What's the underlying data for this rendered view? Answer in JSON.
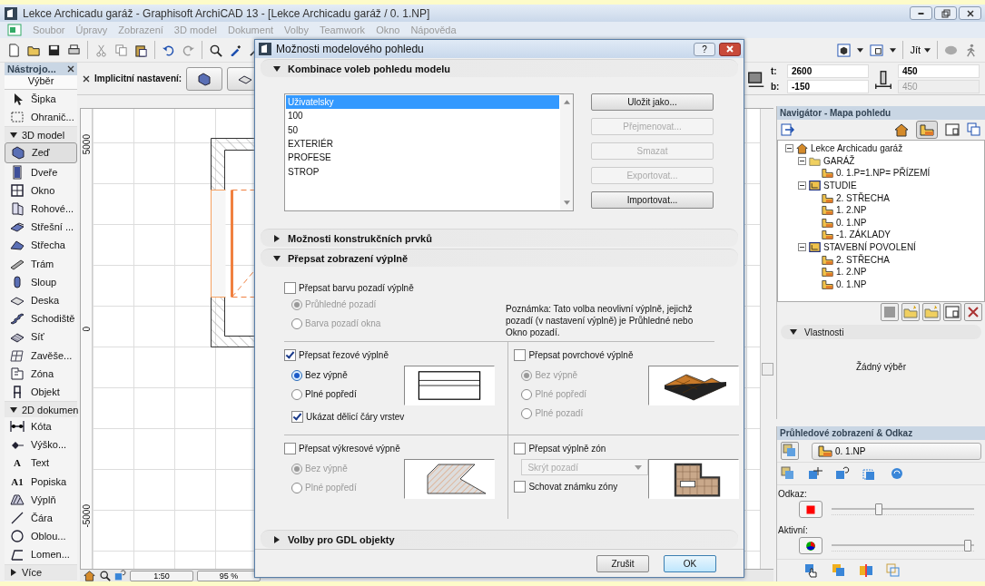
{
  "window": {
    "title": "Lekce Archicadu garáž - Graphisoft ArchiCAD 13 - [Lekce Archicadu garáž / 0. 1.NP]"
  },
  "menu": [
    "Soubor",
    "Úpravy",
    "Zobrazení",
    "3D model",
    "Dokument",
    "Volby",
    "Teamwork",
    "Okno",
    "Nápověda"
  ],
  "toolbar": {
    "go_label": "Jít"
  },
  "toolbox": {
    "title": "Nástrojo...",
    "header": "Výběr",
    "items": [
      {
        "label": "Šipka",
        "selected": false
      },
      {
        "label": "Ohranič...",
        "selected": false
      }
    ],
    "groups": [
      {
        "label": "3D model",
        "expanded": true,
        "items": [
          {
            "label": "Zeď",
            "selected": true
          },
          {
            "label": "Dveře",
            "selected": false
          },
          {
            "label": "Okno",
            "selected": false
          },
          {
            "label": "Rohové...",
            "selected": false
          },
          {
            "label": "Střešní ...",
            "selected": false
          },
          {
            "label": "Střecha",
            "selected": false
          },
          {
            "label": "Trám",
            "selected": false
          },
          {
            "label": "Sloup",
            "selected": false
          },
          {
            "label": "Deska",
            "selected": false
          },
          {
            "label": "Schodiště",
            "selected": false
          },
          {
            "label": "Síť",
            "selected": false
          },
          {
            "label": "Zavěše...",
            "selected": false
          },
          {
            "label": "Zóna",
            "selected": false
          },
          {
            "label": "Objekt",
            "selected": false
          }
        ]
      },
      {
        "label": "2D dokumen",
        "expanded": true,
        "items": [
          {
            "label": "Kóta",
            "selected": false
          },
          {
            "label": "Výško...",
            "selected": false
          },
          {
            "label": "Text",
            "selected": false,
            "glyph": "A"
          },
          {
            "label": "Popiska",
            "selected": false,
            "glyph": "A1"
          },
          {
            "label": "Výplň",
            "selected": false
          },
          {
            "label": "Čára",
            "selected": false
          },
          {
            "label": "Oblou...",
            "selected": false
          },
          {
            "label": "Lomen...",
            "selected": false
          }
        ]
      },
      {
        "label": "Více",
        "expanded": false
      }
    ]
  },
  "info_box": {
    "label": "Implicitní nastavení:",
    "top_label": "t:",
    "top_value": "2600",
    "bottom_label": "b:",
    "bottom_value": "-150",
    "fields": [
      {
        "value": "450",
        "disabled": false
      },
      {
        "value": "450",
        "disabled": true
      }
    ]
  },
  "canvas": {
    "ruler_labels": [
      "5000",
      "0",
      "-5000"
    ],
    "scale": "1:50",
    "zoom": "95 %"
  },
  "navigator": {
    "title": "Navigátor - Mapa pohledu",
    "tree": [
      {
        "label": "Lekce Archicadu garáž",
        "expanded": true,
        "children": [
          {
            "label": "GARÁŽ",
            "kind": "folder",
            "expanded": true,
            "children": [
              {
                "label": "0. 1.P=1.NP= PŘÍZEMÍ"
              }
            ]
          },
          {
            "label": "STUDIE",
            "kind": "set",
            "expanded": true,
            "children": [
              {
                "label": "2. STŘECHA"
              },
              {
                "label": "1. 2.NP"
              },
              {
                "label": "0. 1.NP"
              },
              {
                "label": "-1. ZÁKLADY"
              }
            ]
          },
          {
            "label": "STAVEBNÍ POVOLENÍ",
            "kind": "set",
            "expanded": true,
            "children": [
              {
                "label": "2. STŘECHA"
              },
              {
                "label": "1. 2.NP"
              },
              {
                "label": "0. 1.NP"
              }
            ]
          }
        ]
      }
    ]
  },
  "properties": {
    "title": "Vlastnosti",
    "empty_text": "Žádný výběr"
  },
  "trace": {
    "title": "Průhledové zobrazení & Odkaz",
    "story": "0. 1.NP",
    "sliders": [
      {
        "label": "Odkaz:",
        "level": 0.34
      },
      {
        "label": "Aktivní:",
        "level": 1
      }
    ]
  },
  "dialog": {
    "title": "Možnosti modelového pohledu",
    "help_button": "?",
    "combinations": {
      "title": "Kombinace voleb pohledu modelu",
      "expanded": true,
      "list": [
        {
          "label": "Uživatelsky",
          "selected": true
        },
        {
          "label": "100",
          "selected": false
        },
        {
          "label": "50",
          "selected": false
        },
        {
          "label": "EXTERIÉR",
          "selected": false
        },
        {
          "label": "PROFESE",
          "selected": false
        },
        {
          "label": "STROP",
          "selected": false
        }
      ],
      "buttons": [
        {
          "label": "Uložit jako...",
          "disabled": false
        },
        {
          "label": "Přejmenovat...",
          "disabled": true
        },
        {
          "label": "Smazat",
          "disabled": true
        },
        {
          "label": "Exportovat...",
          "disabled": true
        },
        {
          "label": "Importovat...",
          "disabled": false
        }
      ]
    },
    "construction": {
      "title": "Možnosti konstrukčních prvků",
      "expanded": false
    },
    "fill_override": {
      "title": "Přepsat zobrazení výplně",
      "expanded": true,
      "background": {
        "label": "Přepsat barvu pozadí výplně",
        "checked": false,
        "options": [
          {
            "label": "Průhledné pozadí",
            "selected": true
          },
          {
            "label": "Barva pozadí okna",
            "selected": false
          }
        ],
        "note": "Poznámka: Tato volba neovlivní výplně, jejichž pozadí (v nastavení výplně) je Průhledné nebo Okno pozadí."
      },
      "groups": [
        {
          "kind": "cut",
          "label": "Přepsat řezové výplně",
          "checked": true,
          "options": [
            {
              "label": "Bez výpně",
              "selected": true
            },
            {
              "label": "Plné popředí",
              "selected": false
            }
          ],
          "extra_check": {
            "label": "Ukázat dělicí čáry vrstev",
            "checked": true
          }
        },
        {
          "kind": "surface",
          "label": "Přepsat povrchové výplně",
          "checked": false,
          "options": [
            {
              "label": "Bez výpně",
              "selected": true
            },
            {
              "label": "Plné popředí",
              "selected": false
            },
            {
              "label": "Plné pozadí",
              "selected": false
            }
          ]
        },
        {
          "kind": "drafting",
          "label": "Přepsat výkresové výpně",
          "checked": false,
          "options": [
            {
              "label": "Bez výpně",
              "selected": true
            },
            {
              "label": "Plné popředí",
              "selected": false
            }
          ]
        },
        {
          "kind": "zone",
          "label": "Přepsat výplně zón",
          "checked": false,
          "dropdown": "Skrýt pozadí",
          "extra_check": {
            "label": "Schovat známku zóny",
            "checked": false
          }
        }
      ]
    },
    "gdl": {
      "title": "Volby pro GDL objekty",
      "expanded": false
    },
    "buttons": [
      {
        "label": "Zrušit",
        "kind": "normal"
      },
      {
        "label": "OK",
        "kind": "default"
      }
    ]
  }
}
